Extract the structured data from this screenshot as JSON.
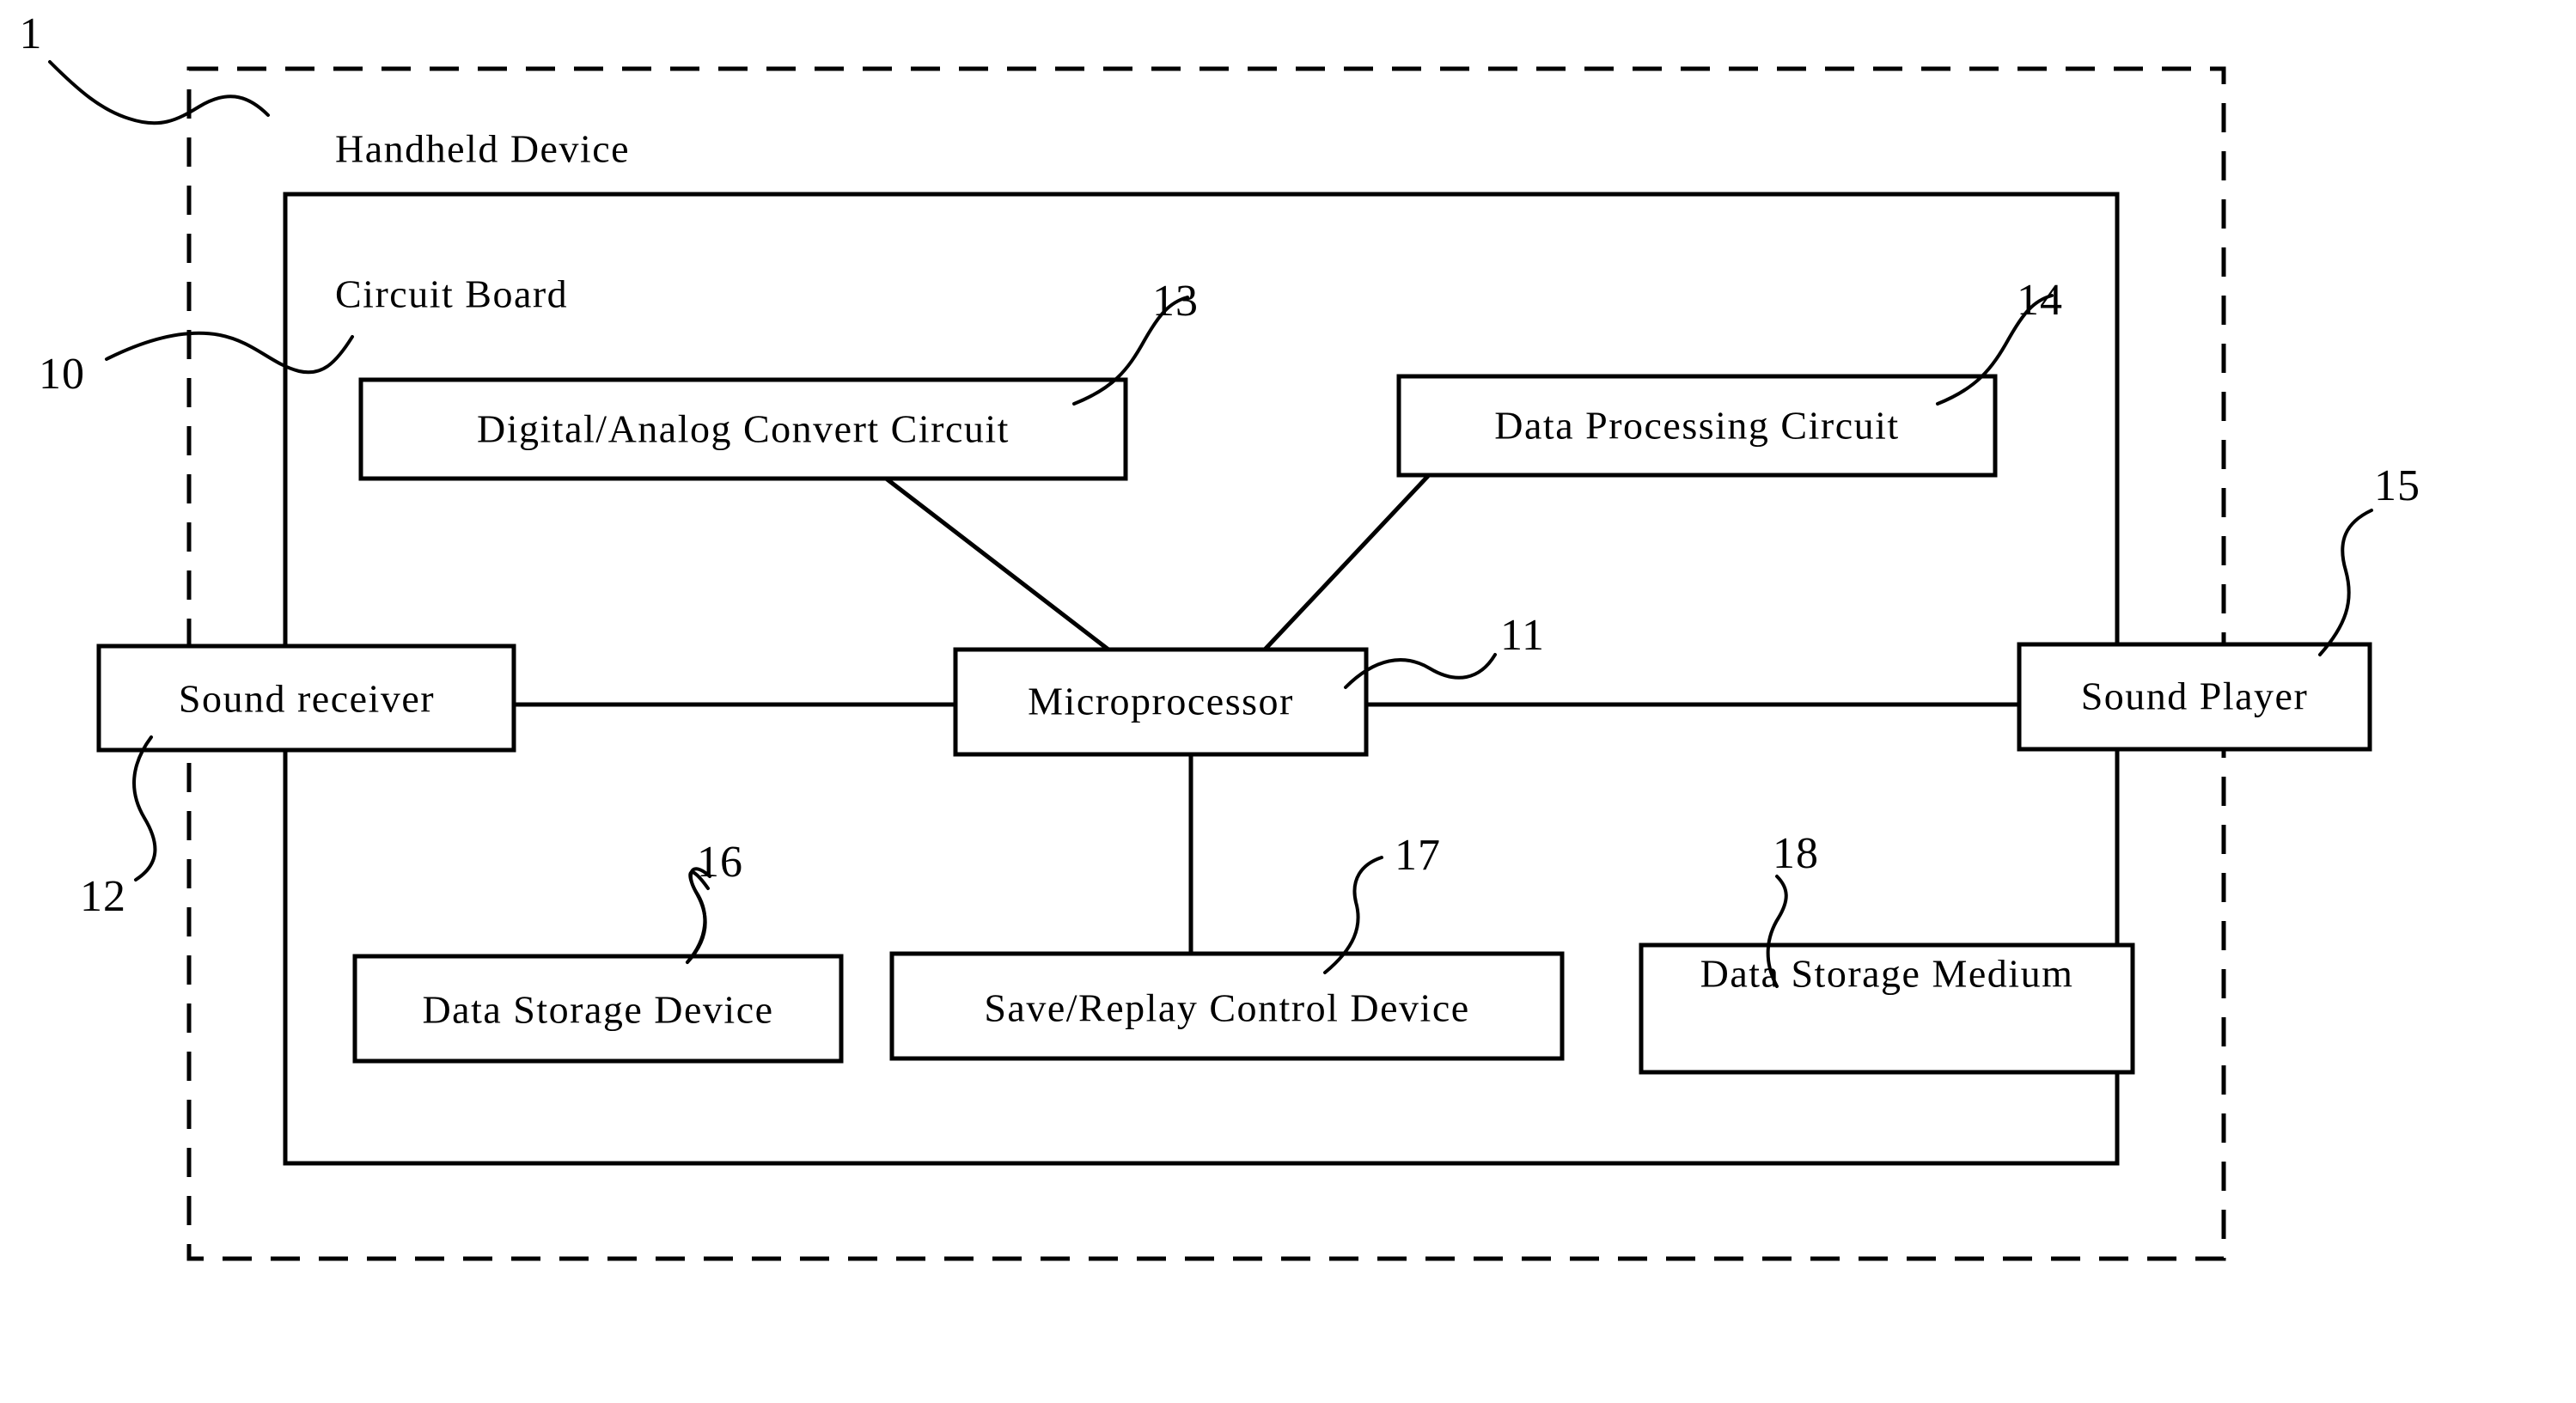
{
  "figure": {
    "type": "patent-block-diagram",
    "background": "#ffffff",
    "line_color": "#000000"
  },
  "enclosures": [
    {
      "key": "handheld_device",
      "label": "Handheld Device",
      "ref": "1",
      "style": "dashed"
    },
    {
      "key": "circuit_board",
      "label": "Circuit Board",
      "ref": "10",
      "style": "solid"
    }
  ],
  "blocks": [
    {
      "key": "dac",
      "label": "Digital/Analog Convert Circuit",
      "ref": "13"
    },
    {
      "key": "data_processing",
      "label": "Data Processing Circuit",
      "ref": "14"
    },
    {
      "key": "sound_receiver",
      "label": "Sound receiver",
      "ref": "12"
    },
    {
      "key": "microprocessor",
      "label": "Microprocessor",
      "ref": "11"
    },
    {
      "key": "sound_player",
      "label": "Sound Player",
      "ref": "15"
    },
    {
      "key": "data_storage_device",
      "label": "Data Storage Device",
      "ref": "16"
    },
    {
      "key": "save_replay_control",
      "label": "Save/Replay Control Device",
      "ref": "17"
    },
    {
      "key": "data_storage_medium",
      "label": "Data Storage Medium",
      "ref": "18"
    }
  ],
  "connections": [
    {
      "from": "sound_receiver",
      "to": "microprocessor"
    },
    {
      "from": "microprocessor",
      "to": "sound_player"
    },
    {
      "from": "dac",
      "to": "microprocessor"
    },
    {
      "from": "data_processing",
      "to": "microprocessor"
    },
    {
      "from": "microprocessor",
      "to": "save_replay_control"
    }
  ]
}
